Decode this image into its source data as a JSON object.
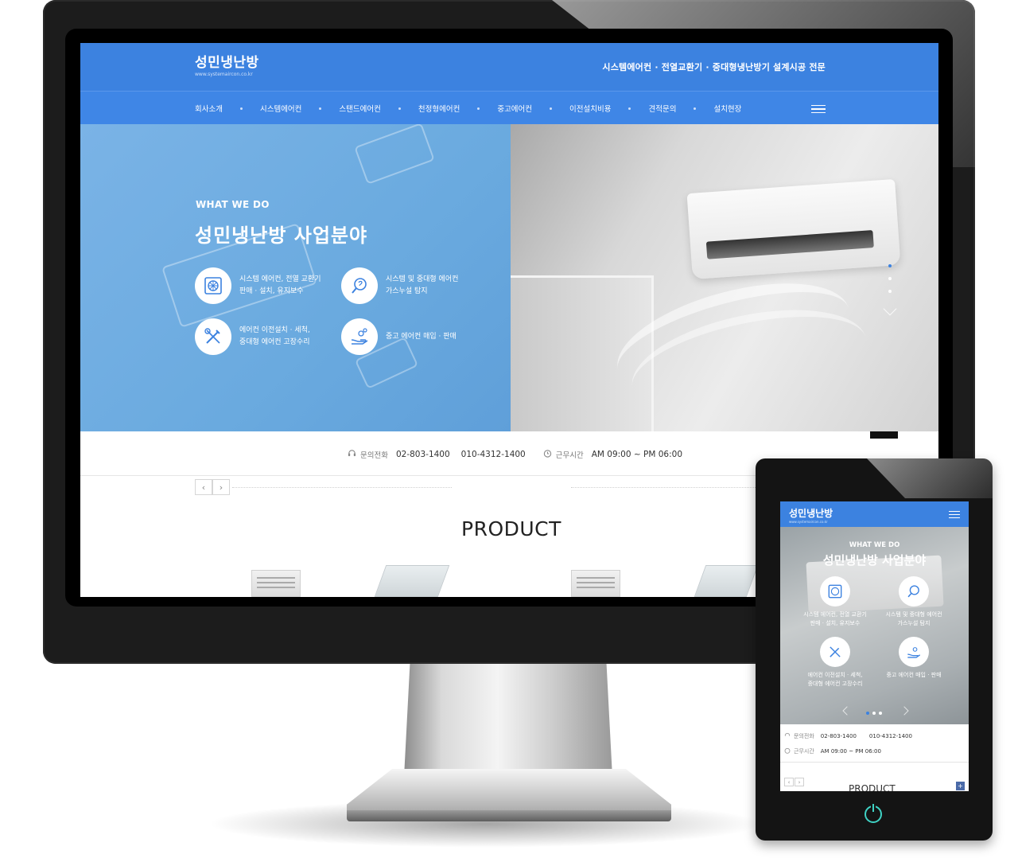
{
  "site": {
    "logo_text": "성민냉난방",
    "logo_url": "www.systemaircon.co.kr",
    "slogan": "시스템에어컨 · 전열교환기 · 중대형냉난방기 설계시공 전문"
  },
  "nav": {
    "items": [
      "회사소개",
      "시스템에어컨",
      "스탠드에어컨",
      "천정형에어컨",
      "중고에어컨",
      "이전설치비용",
      "견적문의",
      "설치현장"
    ]
  },
  "hero": {
    "eyebrow": "WHAT WE DO",
    "title": "성민냉난방 사업분야",
    "features": [
      {
        "text": "시스템 에어컨, 전열 교환기\n판매 · 설치, 유지보수",
        "icon": "aircon-unit-icon"
      },
      {
        "text": "시스템 및 중대형 에어컨\n가스누설 탐지",
        "icon": "leak-detect-icon"
      },
      {
        "text": "에어컨 이전설치 · 세척,\n중대형 에어컨 고장수리",
        "icon": "tools-icon"
      },
      {
        "text": "중고 에어컨 매입 · 판매",
        "icon": "hand-coins-icon"
      }
    ]
  },
  "contact": {
    "phone_label": "문의전화",
    "phone1": "02-803-1400",
    "phone2": "010-4312-1400",
    "hours_label": "근무시간",
    "hours": "AM 09:00 ~ PM 06:00"
  },
  "product": {
    "title": "PRODUCT",
    "prev": "‹",
    "next": "›"
  },
  "mobile": {
    "eyebrow": "WHAT WE DO",
    "title": "성민냉난방 사업분야",
    "features": [
      "시스템 에어컨, 전열 교환기\n판매 · 설치, 유지보수",
      "시스템 및 중대형 에어컨\n가스누설 탐지",
      "에어컨 이전설치 · 세척,\n중대형 에어컨 고장수리",
      "중고 에어컨 매입 · 판매"
    ],
    "product_title": "PRODUCT",
    "plus": "+"
  },
  "colors": {
    "brand_blue": "#3c82e0",
    "hero_blue": "#6aaadf",
    "power_led": "#3fd2c4"
  }
}
